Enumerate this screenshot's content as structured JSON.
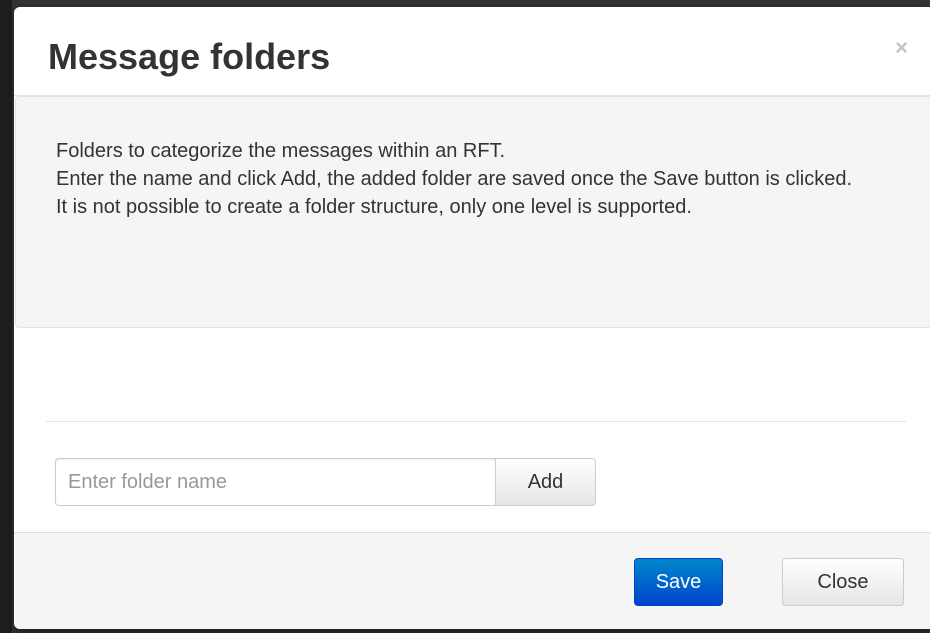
{
  "dialog": {
    "title": "Message folders",
    "close_glyph": "×"
  },
  "info": {
    "lines": [
      "Folders to categorize the messages within an RFT.",
      "Enter the name and click Add, the added folder are saved once the Save button is clicked.",
      "It is not possible to create a folder structure, only one level is supported."
    ]
  },
  "form": {
    "folder_input_placeholder": "Enter folder name",
    "folder_input_value": "",
    "add_label": "Add"
  },
  "footer": {
    "save_label": "Save",
    "close_label": "Close"
  },
  "icons": {
    "close": "close-icon"
  },
  "colors": {
    "primary": "#0055cc",
    "panel_bg": "#f5f5f5",
    "title_text": "#333333"
  }
}
